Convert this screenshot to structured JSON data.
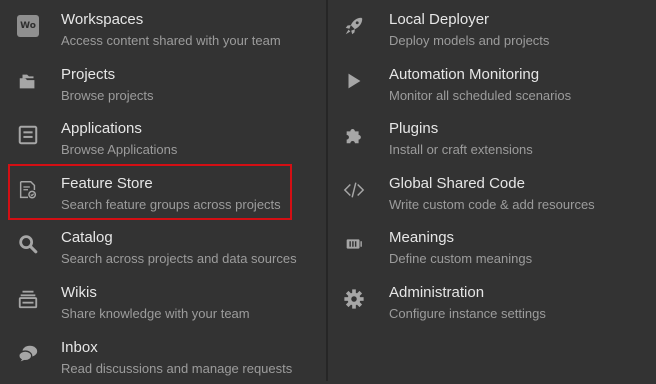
{
  "left_items": [
    {
      "title": "Workspaces",
      "desc": "Access content shared with your team",
      "icon": "workspaces-icon",
      "badge": "Wo"
    },
    {
      "title": "Projects",
      "desc": "Browse projects",
      "icon": "folder-icon"
    },
    {
      "title": "Applications",
      "desc": "Browse Applications",
      "icon": "applications-icon"
    },
    {
      "title": "Feature Store",
      "desc": "Search feature groups across projects",
      "icon": "feature-store-icon",
      "highlighted": true
    },
    {
      "title": "Catalog",
      "desc": "Search across projects and data sources",
      "icon": "search-icon"
    },
    {
      "title": "Wikis",
      "desc": "Share knowledge with your team",
      "icon": "wiki-icon"
    },
    {
      "title": "Inbox",
      "desc": "Read discussions and manage requests",
      "icon": "chat-icon"
    }
  ],
  "right_items": [
    {
      "title": "Local Deployer",
      "desc": "Deploy models and projects",
      "icon": "rocket-icon"
    },
    {
      "title": "Automation Monitoring",
      "desc": "Monitor all scheduled scenarios",
      "icon": "play-icon"
    },
    {
      "title": "Plugins",
      "desc": "Install or craft extensions",
      "icon": "puzzle-icon"
    },
    {
      "title": "Global Shared Code",
      "desc": "Write custom code & add resources",
      "icon": "code-icon"
    },
    {
      "title": "Meanings",
      "desc": "Define custom meanings",
      "icon": "meanings-icon"
    },
    {
      "title": "Administration",
      "desc": "Configure instance settings",
      "icon": "gear-icon"
    }
  ],
  "colors": {
    "background": "#333333",
    "title": "#e6e6e6",
    "description": "#9c9c9c",
    "icon": "#a6a6a6",
    "highlight": "#d40f14"
  }
}
